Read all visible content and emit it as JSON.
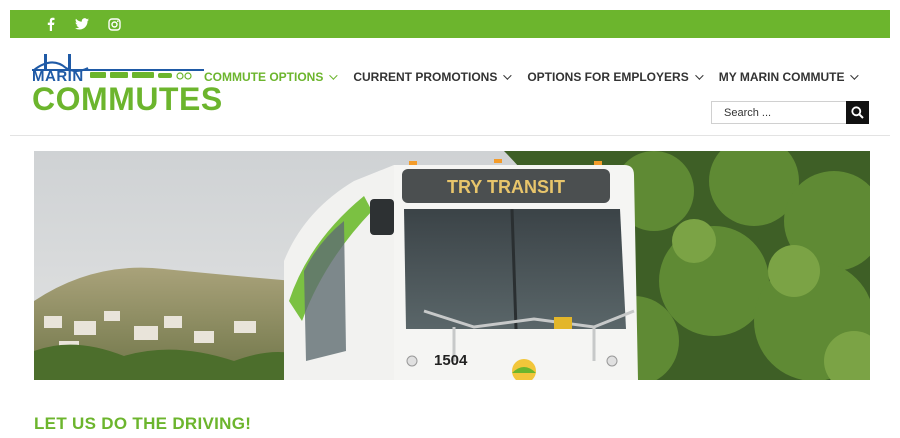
{
  "social": [
    {
      "name": "facebook-icon",
      "glyph": "f"
    },
    {
      "name": "twitter-icon",
      "glyph": ""
    },
    {
      "name": "instagram-icon",
      "glyph": ""
    }
  ],
  "logo": {
    "line1": "MARIN",
    "line2": "COMMUTES"
  },
  "nav": {
    "items": [
      {
        "label": "COMMUTE OPTIONS"
      },
      {
        "label": "CURRENT PROMOTIONS"
      },
      {
        "label": "OPTIONS FOR EMPLOYERS"
      },
      {
        "label": "MY MARIN COMMUTE"
      }
    ]
  },
  "search": {
    "placeholder": "Search ..."
  },
  "hero": {
    "bus_sign": "TRY TRANSIT",
    "bus_number": "1504"
  },
  "main": {
    "headline": "LET US DO THE DRIVING!"
  },
  "colors": {
    "brand_green": "#6cb52d",
    "brand_blue": "#1f5aa6"
  }
}
